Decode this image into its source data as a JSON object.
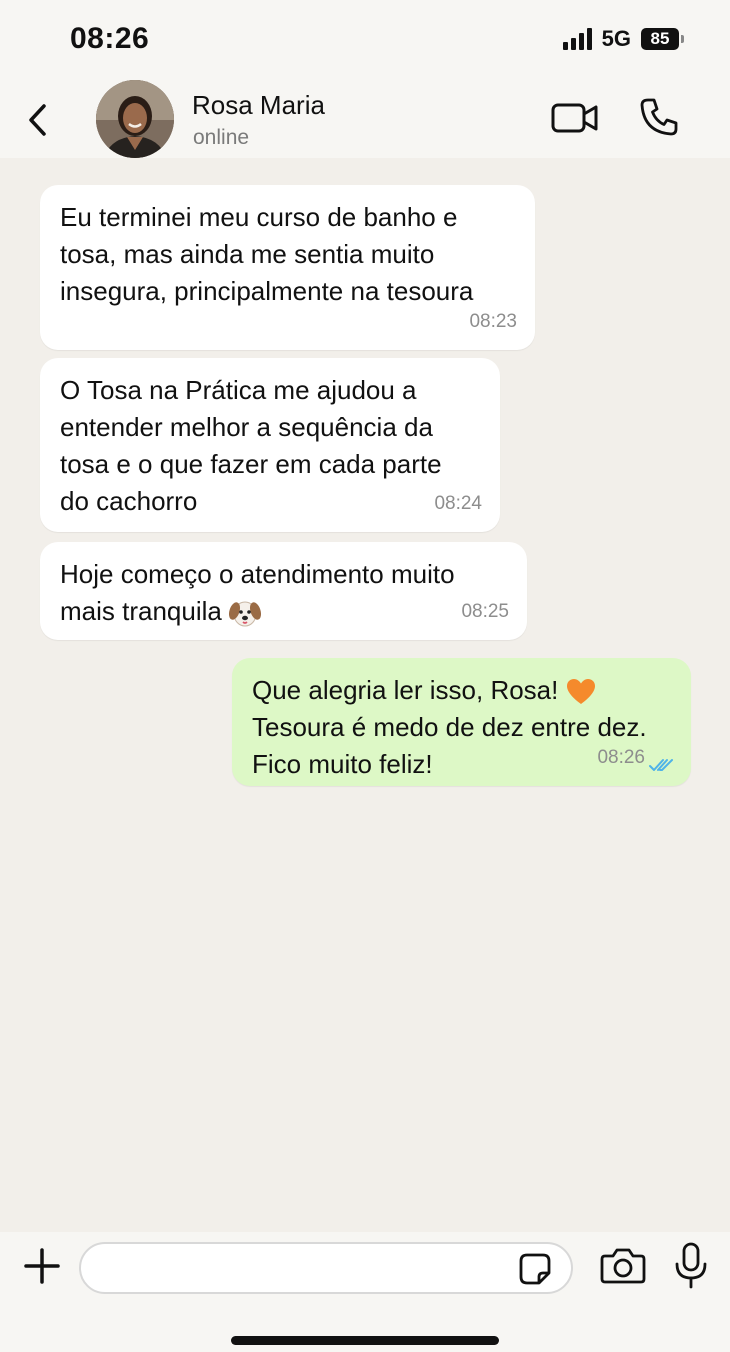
{
  "status_bar": {
    "time": "08:26",
    "network": "5G",
    "battery": "85"
  },
  "contact": {
    "name": "Rosa Maria",
    "status": "online"
  },
  "messages": [
    {
      "direction": "incoming",
      "lines": [
        "Eu terminei meu curso de banho e",
        "tosa, mas ainda me sentia muito",
        "insegura, principalmente na tesoura"
      ],
      "time": "08:23"
    },
    {
      "direction": "incoming",
      "lines": [
        "O Tosa na Prática me ajudou a",
        "entender melhor a sequência da",
        "tosa e o que fazer em cada parte",
        "do cachorro"
      ],
      "time": "08:24"
    },
    {
      "direction": "incoming",
      "lines": [
        "Hoje começo o atendimento muito",
        "mais tranquila"
      ],
      "emoji": "dog-face",
      "time": "08:25"
    },
    {
      "direction": "outgoing",
      "lines": [
        "Que alegria ler isso, Rosa!",
        "Tesoura é medo de dez entre dez.",
        "Fico muito feliz!"
      ],
      "emoji": "orange-heart",
      "time": "08:26",
      "read": true
    }
  ],
  "input": {
    "placeholder": ""
  },
  "colors": {
    "outgoing_bubble": "#ddf8c6",
    "incoming_bubble": "#ffffff",
    "read_ticks": "#4fb3e8",
    "heart": "#f58a2c"
  }
}
